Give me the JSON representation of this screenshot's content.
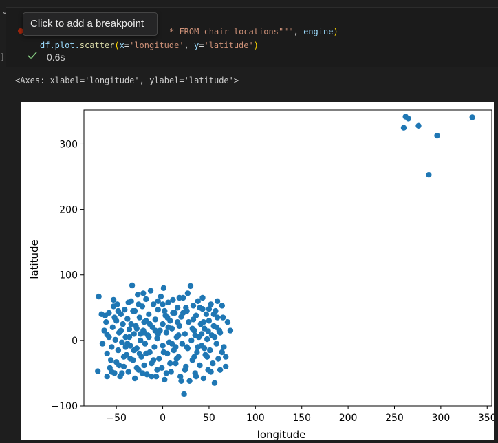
{
  "cell": {
    "code_line1": {
      "keyword": "* FROM chair_locations",
      "quotes": "\"\"\"",
      "comma": ", ",
      "engine": "engine",
      "close_paren": ")"
    },
    "code_line2": {
      "prefix": "df.plot.",
      "fn": "scatter",
      "open": "(",
      "x_kw": "x",
      "x_eq": "=",
      "x_val": "'longitude'",
      "sep": ", ",
      "y_kw": "y",
      "y_eq": "=",
      "y_val": "'latitude'",
      "close": ")"
    },
    "tooltip": "Click to add a breakpoint",
    "status_time": "0.6s",
    "output_repr": "<Axes: xlabel='longitude', ylabel='latitude'>"
  },
  "colors": {
    "point": "#1f77b4",
    "background": "#1e1e1e",
    "check": "#89d185",
    "breakpoint": "#a1260d"
  },
  "icons": {
    "collapse": "chevron-down-icon",
    "status": "check-icon",
    "breakpoint": "breakpoint-dot-icon"
  },
  "chart_data": {
    "type": "scatter",
    "title": "",
    "xlabel": "longitude",
    "ylabel": "latitude",
    "xlim": [
      -85,
      355
    ],
    "ylim": [
      -100,
      352
    ],
    "xticks": [
      -50,
      0,
      50,
      100,
      150,
      200,
      250,
      300,
      350
    ],
    "yticks": [
      -100,
      0,
      100,
      200,
      300
    ],
    "grid": false,
    "legend": "none",
    "points": [
      [
        260,
        325
      ],
      [
        262,
        342
      ],
      [
        265,
        339
      ],
      [
        276,
        328
      ],
      [
        296,
        313
      ],
      [
        334,
        341
      ],
      [
        287,
        253
      ],
      [
        -69,
        67
      ],
      [
        -70,
        -47
      ],
      [
        -62,
        38
      ],
      [
        -61,
        28
      ],
      [
        -60,
        9
      ],
      [
        -60,
        -20
      ],
      [
        -58,
        42
      ],
      [
        -57,
        -42
      ],
      [
        -55,
        -10
      ],
      [
        -54,
        20
      ],
      [
        -53,
        52
      ],
      [
        -52,
        -50
      ],
      [
        -51,
        1
      ],
      [
        -50,
        30
      ],
      [
        -50,
        -33
      ],
      [
        -49,
        55
      ],
      [
        -48,
        -15
      ],
      [
        -47,
        12
      ],
      [
        -46,
        -55
      ],
      [
        -45,
        40
      ],
      [
        -44,
        -3
      ],
      [
        -43,
        25
      ],
      [
        -42,
        -40
      ],
      [
        -41,
        47
      ],
      [
        -40,
        5
      ],
      [
        -39,
        -22
      ],
      [
        -38,
        33
      ],
      [
        -37,
        -48
      ],
      [
        -36,
        17
      ],
      [
        -35,
        -8
      ],
      [
        -34,
        60
      ],
      [
        -33,
        84
      ],
      [
        -32,
        -30
      ],
      [
        -31,
        10
      ],
      [
        -30,
        45
      ],
      [
        -30,
        -58
      ],
      [
        -29,
        22
      ],
      [
        -28,
        -12
      ],
      [
        -27,
        70
      ],
      [
        -26,
        -45
      ],
      [
        -25,
        35
      ],
      [
        -24,
        0
      ],
      [
        -23,
        -25
      ],
      [
        -22,
        52
      ],
      [
        -21,
        15
      ],
      [
        -20,
        -38
      ],
      [
        -20,
        28
      ],
      [
        -19,
        -5
      ],
      [
        -18,
        63
      ],
      [
        -17,
        -52
      ],
      [
        -16,
        8
      ],
      [
        -15,
        40
      ],
      [
        -14,
        -18
      ],
      [
        -13,
        76
      ],
      [
        -12,
        -35
      ],
      [
        -11,
        20
      ],
      [
        -10,
        55
      ],
      [
        -9,
        -10
      ],
      [
        -8,
        32
      ],
      [
        -7,
        -55
      ],
      [
        -6,
        3
      ],
      [
        -5,
        47
      ],
      [
        -4,
        -28
      ],
      [
        -3,
        15
      ],
      [
        -2,
        67
      ],
      [
        -1,
        -42
      ],
      [
        0,
        25
      ],
      [
        0,
        -8
      ],
      [
        1,
        80
      ],
      [
        2,
        -60
      ],
      [
        3,
        38
      ],
      [
        4,
        12
      ],
      [
        5,
        -20
      ],
      [
        6,
        58
      ],
      [
        7,
        -3
      ],
      [
        8,
        30
      ],
      [
        9,
        -48
      ],
      [
        10,
        18
      ],
      [
        11,
        62
      ],
      [
        12,
        -15
      ],
      [
        13,
        42
      ],
      [
        14,
        -35
      ],
      [
        15,
        5
      ],
      [
        16,
        50
      ],
      [
        17,
        -25
      ],
      [
        18,
        22
      ],
      [
        19,
        -55
      ],
      [
        20,
        36
      ],
      [
        21,
        -5
      ],
      [
        22,
        65
      ],
      [
        23,
        -82
      ],
      [
        24,
        10
      ],
      [
        25,
        -40
      ],
      [
        26,
        45
      ],
      [
        27,
        -12
      ],
      [
        28,
        28
      ],
      [
        29,
        -62
      ],
      [
        30,
        83
      ],
      [
        31,
        0
      ],
      [
        32,
        -30
      ],
      [
        33,
        53
      ],
      [
        34,
        15
      ],
      [
        35,
        -50
      ],
      [
        36,
        38
      ],
      [
        37,
        -18
      ],
      [
        38,
        60
      ],
      [
        39,
        5
      ],
      [
        40,
        -38
      ],
      [
        41,
        25
      ],
      [
        42,
        -8
      ],
      [
        43,
        48
      ],
      [
        44,
        -58
      ],
      [
        45,
        18
      ],
      [
        46,
        -22
      ],
      [
        47,
        40
      ],
      [
        48,
        2
      ],
      [
        49,
        -45
      ],
      [
        50,
        30
      ],
      [
        51,
        -15
      ],
      [
        52,
        55
      ],
      [
        53,
        8
      ],
      [
        54,
        -35
      ],
      [
        55,
        22
      ],
      [
        56,
        -65
      ],
      [
        57,
        45
      ],
      [
        58,
        -5
      ],
      [
        59,
        35
      ],
      [
        60,
        -28
      ],
      [
        61,
        15
      ],
      [
        62,
        -45
      ],
      [
        64,
        53
      ],
      [
        66,
        -10
      ],
      [
        70,
        28
      ],
      [
        73,
        15
      ],
      [
        68,
        -40
      ],
      [
        -65,
        -5
      ],
      [
        -58,
        5
      ],
      [
        -52,
        35
      ],
      [
        -45,
        15
      ],
      [
        -38,
        -5
      ],
      [
        -32,
        45
      ],
      [
        -25,
        -20
      ],
      [
        -18,
        30
      ],
      [
        -10,
        -30
      ],
      [
        -5,
        10
      ],
      [
        5,
        35
      ],
      [
        15,
        -28
      ],
      [
        25,
        50
      ],
      [
        35,
        8
      ],
      [
        45,
        -12
      ],
      [
        55,
        40
      ],
      [
        -42,
        -25
      ],
      [
        -36,
        5
      ],
      [
        -28,
        18
      ],
      [
        -22,
        -50
      ],
      [
        -14,
        25
      ],
      [
        -6,
        -45
      ],
      [
        2,
        45
      ],
      [
        10,
        -5
      ],
      [
        18,
        65
      ],
      [
        26,
        -10
      ],
      [
        34,
        -25
      ],
      [
        42,
        10
      ],
      [
        50,
        48
      ],
      [
        58,
        20
      ],
      [
        -56,
        -30
      ],
      [
        -48,
        45
      ],
      [
        -40,
        -10
      ],
      [
        -34,
        25
      ],
      [
        -26,
        55
      ],
      [
        -18,
        -20
      ],
      [
        -8,
        15
      ],
      [
        0,
        55
      ],
      [
        8,
        -35
      ],
      [
        16,
        28
      ],
      [
        24,
        -45
      ],
      [
        32,
        18
      ],
      [
        40,
        50
      ],
      [
        48,
        -25
      ],
      [
        56,
        5
      ],
      [
        -63,
        15
      ],
      [
        -47,
        -38
      ],
      [
        -31,
        -15
      ],
      [
        -15,
        5
      ],
      [
        1,
        -18
      ],
      [
        17,
        8
      ],
      [
        33,
        32
      ],
      [
        49,
        14
      ],
      [
        65,
        35
      ],
      [
        -53,
        62
      ],
      [
        -37,
        58
      ],
      [
        -21,
        72
      ],
      [
        -5,
        60
      ],
      [
        11,
        42
      ],
      [
        27,
        72
      ],
      [
        43,
        65
      ],
      [
        59,
        60
      ],
      [
        -60,
        -55
      ],
      [
        -44,
        -50
      ],
      [
        -28,
        -42
      ],
      [
        -12,
        -55
      ],
      [
        4,
        -50
      ],
      [
        20,
        -62
      ],
      [
        36,
        -55
      ],
      [
        52,
        -48
      ],
      [
        68,
        -25
      ],
      [
        -66,
        40
      ],
      [
        -24,
        10
      ],
      [
        14,
        -10
      ],
      [
        38,
        -10
      ],
      [
        62,
        12
      ],
      [
        -55,
        -48
      ],
      [
        -35,
        -28
      ],
      [
        -20,
        12
      ],
      [
        6,
        20
      ],
      [
        22,
        42
      ],
      [
        44,
        28
      ],
      [
        64,
        -18
      ]
    ]
  }
}
